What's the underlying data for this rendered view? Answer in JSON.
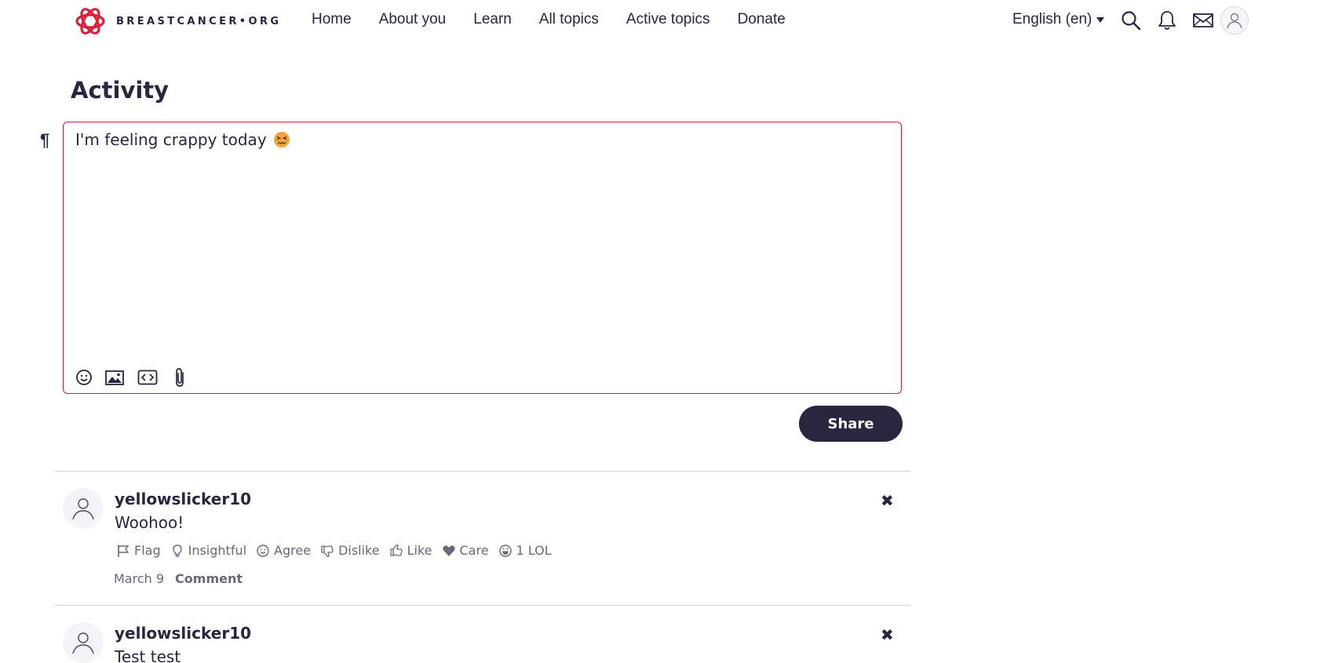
{
  "brand": {
    "name": "BREASTCANCER•ORG",
    "accent_color": "#d91f3c",
    "text_color": "#2b2540"
  },
  "nav": {
    "items": [
      {
        "label": "Home"
      },
      {
        "label": "About you"
      },
      {
        "label": "Learn"
      },
      {
        "label": "All topics"
      },
      {
        "label": "Active topics"
      },
      {
        "label": "Donate"
      }
    ],
    "language": "English (en)",
    "icons": [
      "search-icon",
      "bell-icon",
      "mail-icon",
      "user-avatar-icon"
    ]
  },
  "activity": {
    "title": "Activity",
    "composer": {
      "text": "I'm feeling crappy today",
      "emoji": "confounded-face",
      "tools": [
        "emoji-icon",
        "image-icon",
        "code-icon",
        "attach-icon"
      ],
      "share_label": "Share"
    }
  },
  "posts": [
    {
      "user": "yellowslicker10",
      "body": "Woohoo!",
      "reactions": [
        {
          "label": "Flag",
          "icon": "flag-icon"
        },
        {
          "label": "Insightful",
          "icon": "lightbulb-icon"
        },
        {
          "label": "Agree",
          "icon": "smile-icon"
        },
        {
          "label": "Dislike",
          "icon": "thumbs-down-icon"
        },
        {
          "label": "Like",
          "icon": "thumbs-up-icon"
        },
        {
          "label": "Care",
          "icon": "heart-icon"
        },
        {
          "label": "1 LOL",
          "icon": "laugh-icon"
        }
      ],
      "date": "March 9",
      "comment_label": "Comment",
      "close": "✖"
    },
    {
      "user": "yellowslicker10",
      "body": "Test test",
      "close": "✖"
    }
  ],
  "paragraph_mark": "¶"
}
